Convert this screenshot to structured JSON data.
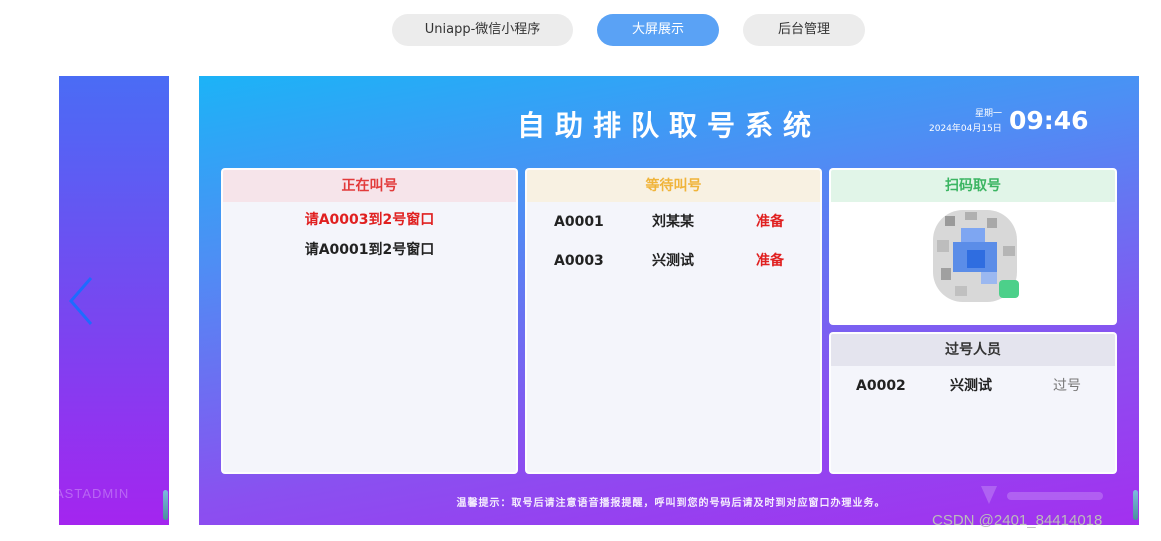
{
  "tabs": [
    {
      "label": "Uniapp-微信小程序",
      "active": false
    },
    {
      "label": "大屏展示",
      "active": true
    },
    {
      "label": "后台管理",
      "active": false
    }
  ],
  "prev_slide": {
    "arrow_icon": "chevron-left-icon",
    "watermark": "ASTADMIN"
  },
  "screen": {
    "title": "自助排队取号系统",
    "weekday": "星期一",
    "date": "2024年04月15日",
    "time": "09:46",
    "calling": {
      "title": "正在叫号",
      "lines": [
        "请A0003到2号窗口",
        "请A0001到2号窗口"
      ]
    },
    "waiting": {
      "title": "等待叫号",
      "rows": [
        {
          "number": "A0001",
          "name": "刘某某",
          "status": "准备"
        },
        {
          "number": "A0003",
          "name": "兴测试",
          "status": "准备"
        }
      ]
    },
    "scan": {
      "title": "扫码取号",
      "qr_icon": "qr-code-icon"
    },
    "passed": {
      "title": "过号人员",
      "rows": [
        {
          "number": "A0002",
          "name": "兴测试",
          "status": "过号"
        }
      ]
    },
    "tip": "温馨提示：取号后请注意语音播报提醒，呼叫到您的号码后请及时到对应窗口办理业务。"
  },
  "watermark": "CSDN @2401_84414018",
  "colors": {
    "accent": "#5aa2f5",
    "calling": "#e23b3b",
    "waiting": "#f0b43a",
    "scan": "#3bb562"
  }
}
